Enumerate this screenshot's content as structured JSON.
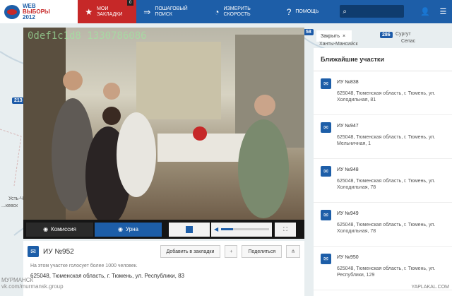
{
  "topbar": {
    "logo_line1": "WEB",
    "logo_line2": "ВЫБОРЫ",
    "logo_line3": "2012",
    "nav": [
      {
        "label": "МОИ ЗАКЛАДКИ",
        "icon": "star-icon",
        "badge": "0"
      },
      {
        "label": "ПОШАГОВЫЙ ПОИСК",
        "icon": "steps-icon"
      },
      {
        "label": "ИЗМЕРИТЬ СКОРОСТЬ",
        "icon": "speedometer-icon"
      },
      {
        "label": "ПОМОЩЬ",
        "icon": "help-icon"
      }
    ]
  },
  "map": {
    "pins": [
      "58",
      "286",
      "213"
    ],
    "cities": [
      "Ханты-Мансийск",
      "Сургут",
      "Сепас",
      "Усть-Ч...",
      "...кевск"
    ]
  },
  "video": {
    "camera_id": "0def1c1d8 1330786086",
    "tab_commission": "Комиссия",
    "tab_urn": "Урна",
    "volume": 0.25
  },
  "info": {
    "uik_title": "ИУ №952",
    "bookmark_button": "Добавить в закладки",
    "bookmark_plus": "+",
    "share_button": "Поделиться",
    "note": "На этом участке голосует более 1000 человек.",
    "address": "625048, Тюменская область, г. Тюмень, ул. Республики, 83"
  },
  "right_panel": {
    "close_label": "Закрыть",
    "close_x": "×",
    "title": "Ближайшие участки",
    "items": [
      {
        "name": "ИУ №838",
        "address": "625048, Тюменская область, г. Тюмень, ул. Холодильная, 81"
      },
      {
        "name": "ИУ №947",
        "address": "625048, Тюменская область, г. Тюмень, ул. Мельничная, 1"
      },
      {
        "name": "ИУ №948",
        "address": "625048, Тюменская область, г. Тюмень, ул. Холодильная, 78"
      },
      {
        "name": "ИУ №949",
        "address": "625048, Тюменская область, г. Тюмень, ул. Холодильная, 78"
      },
      {
        "name": "ИУ №950",
        "address": "625048, Тюменская область, г. Тюмень, ул. Республики, 129"
      }
    ]
  },
  "watermarks": {
    "left_line1": "МУРМАНСК",
    "left_line2": "vk.com/murmansk.group",
    "right": "YAPLAKAL.COM"
  }
}
